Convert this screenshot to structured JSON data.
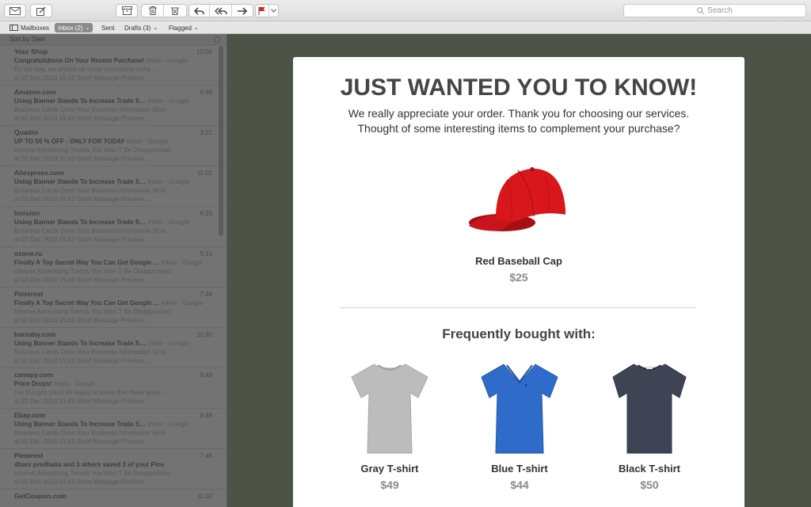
{
  "toolbar": {
    "icons": [
      "compose-mail-icon",
      "new-message-icon",
      "archive-icon",
      "trash-icon",
      "junk-icon",
      "reply-icon",
      "reply-all-icon",
      "forward-icon",
      "flag-icon"
    ],
    "flag_color": "#e0231b",
    "search_placeholder": "Search"
  },
  "favorites": {
    "mailboxes": "Mailboxes",
    "inbox": "Inbox (2)",
    "sent": "Sent",
    "drafts": "Drafts (3)",
    "flagged": "Flagged"
  },
  "list": {
    "sort_label": "Sort by Date",
    "messages": [
      {
        "from": "Your Shop",
        "time": "12:00",
        "subject": "Congratulations On Your Recent Purchase!",
        "mailbox": "Inbox - Google",
        "preview1": "By the way, we picked up some interesting items …",
        "preview2": "at 02 Dec 2016 15:43  Short Message Preview…"
      },
      {
        "from": "Amazon.com",
        "time": "8:49",
        "subject": "Using Banner Stands To Increase Trade S…",
        "mailbox": "Inbox - Google",
        "preview1": "Business Cards Does Your Business Information Stick",
        "preview2": "at 02 Dec 2016 15:43  Short Message Preview…"
      },
      {
        "from": "Quadro",
        "time": "3:21",
        "subject": "UP TO 50 % OFF - ONLY FOR TODAY",
        "mailbox": "Inbox - Google",
        "preview1": "Internet Advertising Trends You Won T Be Disappointed",
        "preview2": "at 02 Dec 2016 15:43  Short Message Preview…"
      },
      {
        "from": "Aliexpress.com",
        "time": "11:02",
        "subject": "Using Banner Stands To Increase Trade S…",
        "mailbox": "Inbox - Google",
        "preview1": "Business Cards Does Your Business Information Stick",
        "preview2": "at 02 Dec 2016 15:43  Short Message Preview…"
      },
      {
        "from": "Invision",
        "time": "6:29",
        "subject": "Using Banner Stands To Increase Trade S…",
        "mailbox": "Inbox - Google",
        "preview1": "Business Cards Does Your Business Information Stick",
        "preview2": "at 02 Dec 2016 15:43  Short Message Preview…"
      },
      {
        "from": "ozone.ru",
        "time": "5:16",
        "subject": "Finally A Top Secret Way You Can Get Google …",
        "mailbox": "Inbox - Google",
        "preview1": "Internet Advertising Trends You Won T Be Disappointed",
        "preview2": "at 02 Dec 2016 15:43  Short Message Preview…"
      },
      {
        "from": "Pinterest",
        "time": "7:48",
        "subject": "Finally A Top Secret Way You Can Get Google …",
        "mailbox": "Inbox - Google",
        "preview1": "Internet Advertising Trends You Won T Be Disappointed",
        "preview2": "at 02 Dec 2016 15:43  Short Message Preview…"
      },
      {
        "from": "barnaby.com",
        "time": "11:30",
        "subject": "Using Banner Stands To Increase Trade S…",
        "mailbox": "Inbox - Google",
        "preview1": "Business Cards Does Your Business Information Stick",
        "preview2": "at 02 Dec 2016 15:43  Short Message Preview…"
      },
      {
        "from": "canopy.com",
        "time": "9:49",
        "subject": "Price Drops!",
        "mailbox": "Inbox - Google",
        "preview1": "I've thought you'd be happy to know that these great…",
        "preview2": "at 02 Dec 2016 15:43  Short Message Preview…"
      },
      {
        "from": "Ebay.com",
        "time": "9:49",
        "subject": "Using Banner Stands To Increase Trade S…",
        "mailbox": "Inbox - Google",
        "preview1": "Business Cards Does Your Business Information Stick",
        "preview2": "at 02 Dec 2016 15:43  Short Message Preview…"
      },
      {
        "from": "Pinterest",
        "time": "7:49",
        "subject": "dhani predhana and 3 others saved 3 of your Pins",
        "mailbox": "",
        "preview1": "Internet Advertising Trends You Won T Be Disappointed",
        "preview2": "at 02 Dec 2016 15:43  Short Message Preview…"
      },
      {
        "from": "GetCoupon.com",
        "time": "11:02",
        "subject": "",
        "mailbox": "",
        "preview1": "",
        "preview2": ""
      }
    ]
  },
  "email": {
    "headline": "JUST WANTED YOU TO KNOW!",
    "intro_line1": "We really appreciate your order. Thank you for choosing our services.",
    "intro_line2": "Thought of some interesting items to complement your purchase?",
    "featured": {
      "name": "Red Baseball Cap",
      "price": "$25",
      "color": "#d8161c"
    },
    "section_title": "Frequently bought with:",
    "products": [
      {
        "name": "Gray T-shirt",
        "price": "$49",
        "color": "#b9b9b9"
      },
      {
        "name": "Blue T-shirt",
        "price": "$44",
        "color": "#2f6cc9"
      },
      {
        "name": "Black T-shirt",
        "price": "$50",
        "color": "#3f4455"
      }
    ]
  }
}
